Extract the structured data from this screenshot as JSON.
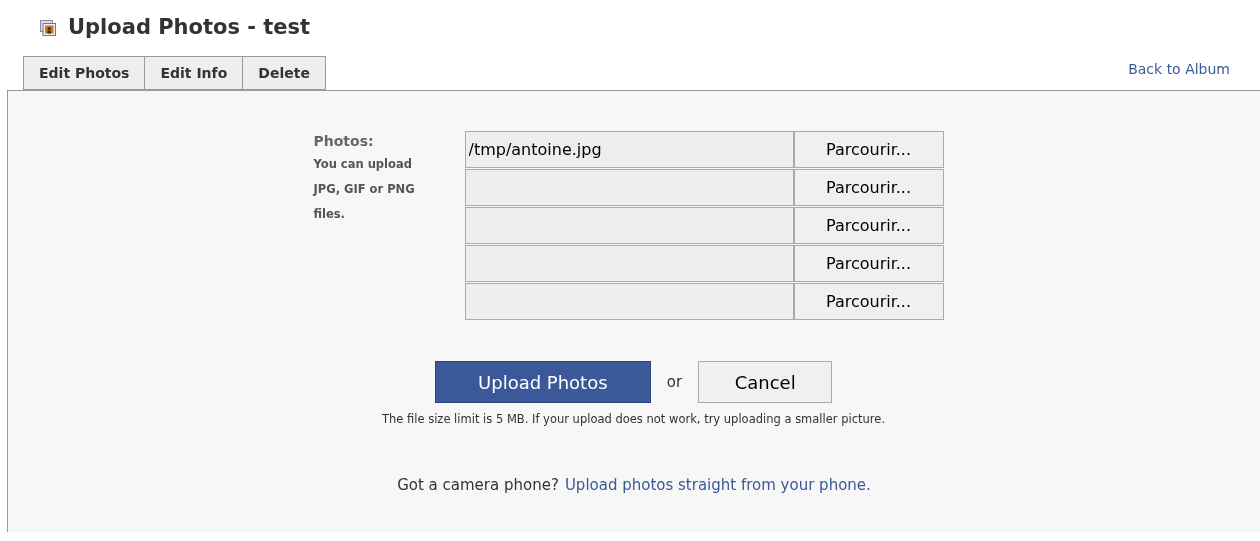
{
  "header": {
    "title": "Upload Photos - test"
  },
  "tabs": [
    {
      "label": "Edit Photos",
      "selected": false
    },
    {
      "label": "Edit Info",
      "selected": false
    },
    {
      "label": "Delete",
      "selected": false
    }
  ],
  "back_link": "Back to Album",
  "form": {
    "label": "Photos:",
    "hint": "You can upload JPG, GIF or PNG files.",
    "files": [
      {
        "value": "/tmp/antoine.jpg",
        "button": "Parcourir..."
      },
      {
        "button": "Parcourir..."
      },
      {
        "button": "Parcourir..."
      },
      {
        "button": "Parcourir..."
      },
      {
        "button": "Parcourir..."
      }
    ]
  },
  "actions": {
    "submit": "Upload Photos",
    "separator": "or",
    "cancel": "Cancel"
  },
  "note": "The file size limit is 5 MB. If your upload does not work, try uploading a smaller picture.",
  "phone": {
    "question": "Got a camera phone?",
    "link": "Upload photos straight from your phone."
  }
}
